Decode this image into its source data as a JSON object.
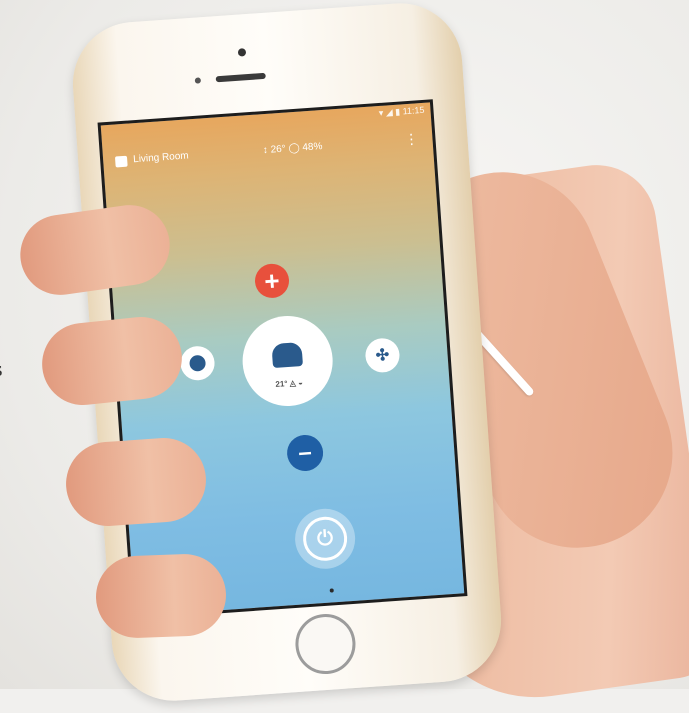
{
  "cut_letter": "s",
  "status_bar": {
    "text": "▾ ◢ ▮ 11:15"
  },
  "app_bar": {
    "room_label": "Living Room",
    "readout": "↕ 26° ◯ 48%",
    "menu_icon": "⋮"
  },
  "controls": {
    "plus_icon": "+",
    "minus_icon": "–",
    "fan_icon": "✣",
    "mode_status": "21° ◬ ◒",
    "power_icon": "⏻"
  },
  "colors": {
    "plus": "#e8503c",
    "minus": "#1f5fa5",
    "accent": "#2a5a8c"
  }
}
